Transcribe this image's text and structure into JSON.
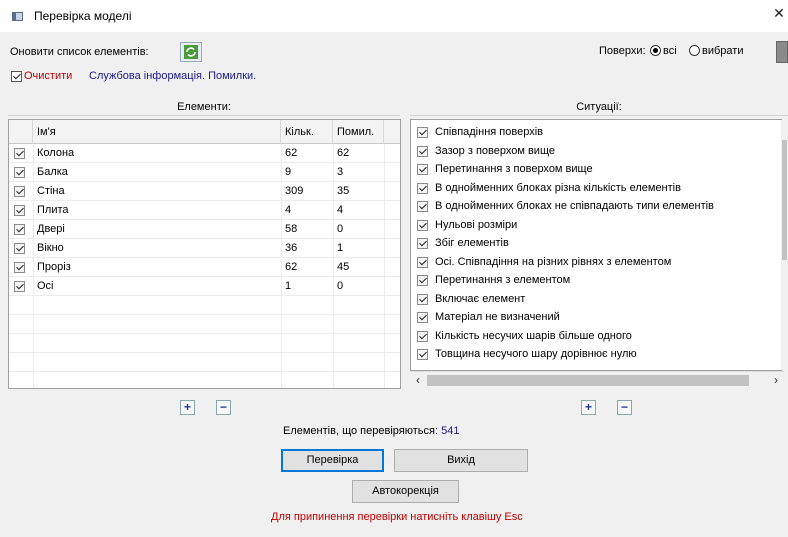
{
  "window": {
    "title": "Перевірка моделі",
    "close_glyph": "✕"
  },
  "top": {
    "refresh_label": "Оновити список елементів:",
    "surfaces_label": "Поверхи:",
    "radio_all": "всі",
    "radio_select": "вибрати",
    "clear_label": "Очистити",
    "service_info": "Службова інформація. Помилки."
  },
  "elements": {
    "header": "Елементи:",
    "columns": {
      "name": "Ім'я",
      "count": "Кільк.",
      "errors": "Помил."
    },
    "rows": [
      {
        "name": "Колона",
        "count": "62",
        "errors": "62",
        "checked": true
      },
      {
        "name": "Балка",
        "count": "9",
        "errors": "3",
        "checked": true
      },
      {
        "name": "Стіна",
        "count": "309",
        "errors": "35",
        "checked": true
      },
      {
        "name": "Плита",
        "count": "4",
        "errors": "4",
        "checked": true
      },
      {
        "name": "Двері",
        "count": "58",
        "errors": "0",
        "checked": true
      },
      {
        "name": "Вікно",
        "count": "36",
        "errors": "1",
        "checked": true
      },
      {
        "name": "Проріз",
        "count": "62",
        "errors": "45",
        "checked": true
      },
      {
        "name": "Осі",
        "count": "1",
        "errors": "0",
        "checked": true
      }
    ]
  },
  "situations": {
    "header": "Ситуації:",
    "items": [
      "Співпадіння поверхів",
      "Зазор з поверхом вище",
      "Перетинання з поверхом вище",
      "В однойменних блоках  різна кількість елементів",
      "В однойменних блоках  не співпадають типи елементів",
      "Нульові розміри",
      "Збіг елементів",
      "Осі. Співпадіння на різних рівнях з елементом",
      "Перетинання з елементом",
      "Включає елемент",
      "Матеріал не визначений",
      "Кількість несучих шарів більше одного",
      "Товщина несучого шару дорівнює нулю"
    ]
  },
  "footer": {
    "plus": "+",
    "minus": "−",
    "checked_label": "Елементів, що перевіряються:",
    "checked_count": "541",
    "check_button": "Перевірка",
    "exit_button": "Вихід",
    "autocorrect_button": "Автокорекція",
    "esc_hint": "Для припинення перевірки натисніть клавішу Esc"
  },
  "colors": {
    "accent": "#0078d7",
    "hint_red": "#c00000",
    "link_blue": "#1a1a8a"
  },
  "icons": [
    "app-icon",
    "refresh-icon",
    "print-icon",
    "close-icon"
  ]
}
